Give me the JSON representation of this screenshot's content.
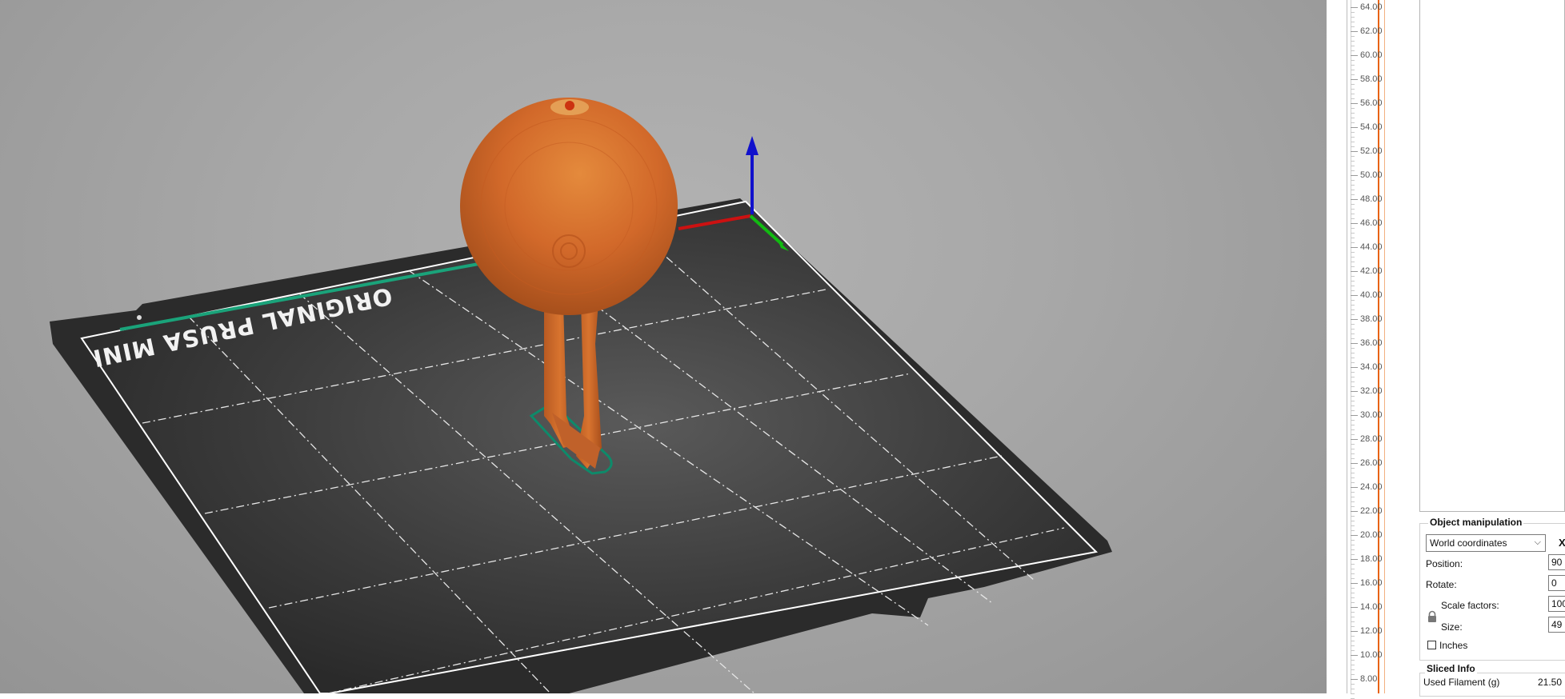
{
  "viewport": {
    "bed_label": "ORIGINAL PRUSA MINI",
    "colors": {
      "model": "#d2692a",
      "bed": "#3a3a3a",
      "axis_x": "#cc1111",
      "axis_y": "#11bb11",
      "axis_z": "#1111cc",
      "outline": "#0e8a6a"
    }
  },
  "layer_slider": {
    "ticks": [
      "64.00",
      "62.00",
      "60.00",
      "58.00",
      "56.00",
      "54.00",
      "52.00",
      "50.00",
      "48.00",
      "46.00",
      "44.00",
      "42.00",
      "40.00",
      "38.00",
      "36.00",
      "34.00",
      "32.00",
      "30.00",
      "28.00",
      "26.00",
      "24.00",
      "22.00",
      "20.00",
      "18.00",
      "16.00",
      "14.00",
      "12.00",
      "10.00",
      "8.00"
    ],
    "accent_color": "#e8620c"
  },
  "object_manipulation": {
    "title": "Object manipulation",
    "coordinate_system": "World coordinates",
    "axis_header": "X",
    "position_label": "Position:",
    "position_value": "90",
    "rotate_label": "Rotate:",
    "rotate_value": "0",
    "scale_label": "Scale factors:",
    "scale_value": "100",
    "size_label": "Size:",
    "size_value": "49",
    "inches_label": "Inches",
    "inches_checked": false
  },
  "sliced_info": {
    "title": "Sliced Info",
    "used_filament_label": "Used Filament (g)",
    "used_filament_value": "21.50"
  }
}
